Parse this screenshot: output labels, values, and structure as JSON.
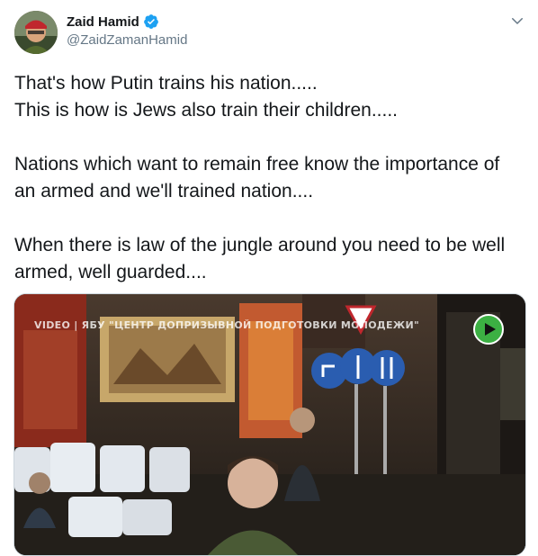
{
  "author": {
    "display_name": "Zaid Hamid",
    "handle": "@ZaidZamanHamid",
    "verified": true
  },
  "tweet": {
    "paragraphs": [
      "That's how Putin trains his nation.....\nThis is how is Jews also train their children.....",
      "Nations which want to remain free know the importance of an armed and we'll trained nation....",
      "When there is law of the jungle around you need to be well armed, well guarded...."
    ]
  },
  "media": {
    "overlay_text": "VIDEO | ЯБУ \"ЦЕНТР ДОПРИЗЫВНОЙ ПОДГОТОВКИ МОЛОДЕЖИ\""
  },
  "icons": {
    "verified": "verified-badge-icon",
    "menu": "chevron-down-icon",
    "play": "play-icon"
  },
  "colors": {
    "accent": "#1da1f2",
    "secondary_text": "#657786",
    "play_green": "#3cb043"
  }
}
